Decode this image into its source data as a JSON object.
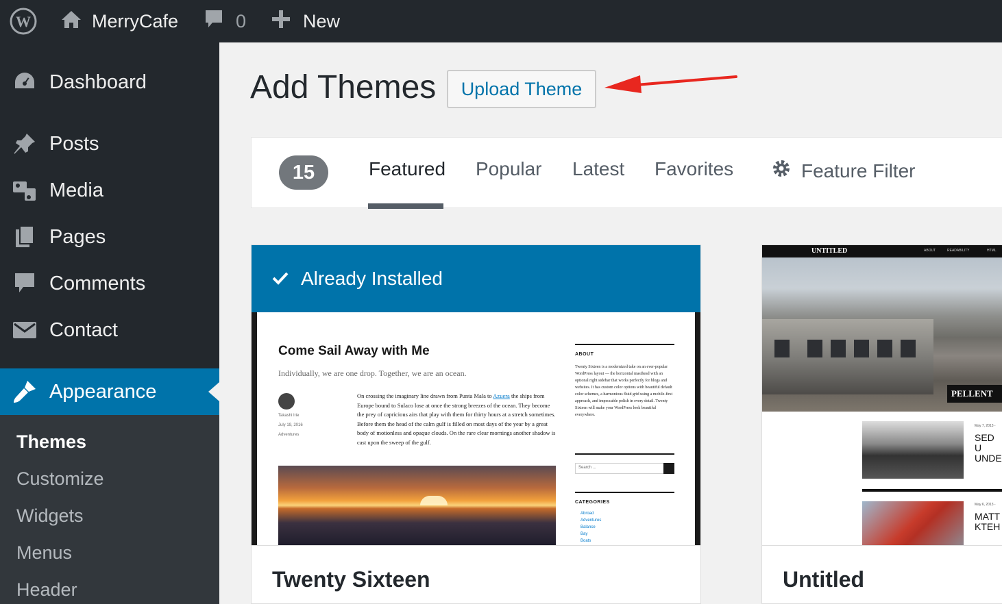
{
  "adminbar": {
    "site_name": "MerryCafe",
    "comment_count": "0",
    "new_label": "New"
  },
  "sidebar": {
    "items": [
      {
        "label": "Dashboard",
        "icon": "dashboard-icon"
      },
      {
        "label": "Posts",
        "icon": "pin-icon"
      },
      {
        "label": "Media",
        "icon": "media-icon"
      },
      {
        "label": "Pages",
        "icon": "pages-icon"
      },
      {
        "label": "Comments",
        "icon": "comment-icon"
      },
      {
        "label": "Contact",
        "icon": "envelope-icon"
      },
      {
        "label": "Appearance",
        "icon": "paintbrush-icon",
        "active": true
      }
    ],
    "submenu": [
      "Themes",
      "Customize",
      "Widgets",
      "Menus",
      "Header"
    ]
  },
  "main": {
    "title": "Add Themes",
    "upload_button": "Upload Theme",
    "theme_count": "15",
    "tabs": [
      "Featured",
      "Popular",
      "Latest",
      "Favorites"
    ],
    "active_tab": "Featured",
    "feature_filter": "Feature Filter"
  },
  "themes": [
    {
      "name": "Twenty Sixteen",
      "status": "Already Installed",
      "preview": {
        "post_title": "Come Sail Away with Me",
        "tagline": "Individually, we are one drop. Together, we are an ocean.",
        "author": "Takashi Irie",
        "date": "July 19, 2016",
        "category": "Adventures",
        "body_before_link": "On crossing the imaginary line drawn from Punta Mala to ",
        "body_link": "Azuera",
        "body_after_link": " the ships from Europe bound to Sulaco lose at once the strong breezes of the ocean. They become the prey of capricious airs that play with them for thirty hours at a stretch sometimes. Before them the head of the calm gulf is filled on most days of the year by a great body of motionless and opaque clouds. On the rare clear mornings another shadow is cast upon the sweep of the gulf.",
        "about_heading": "ABOUT",
        "about_text": "Twenty Sixteen is a modernized take on an ever-popular WordPress layout — the horizontal masthead with an optional right sidebar that works perfectly for blogs and websites. It has custom color options with beautiful default color schemes, a harmonious fluid grid using a mobile-first approach, and impeccable polish in every detail. Twenty Sixteen will make your WordPress look beautiful everywhere.",
        "search_placeholder": "Search ...",
        "categories_heading": "CATEGORIES",
        "categories": [
          "Abroad",
          "Adventures",
          "Balance",
          "Bay",
          "Boats"
        ]
      }
    },
    {
      "name": "Untitled",
      "preview": {
        "logo": "UNTITLED",
        "nav": [
          "ABOUT",
          "READABILITY",
          "HTML"
        ],
        "badge": "PELLENT",
        "date1": "May 7, 2013 -",
        "headline1": "SED U UNDE",
        "date2": "May 6, 2013 -",
        "headline2": "MATT KTEH"
      }
    }
  ],
  "colors": {
    "adminbar_bg": "#23282d",
    "accent_blue": "#0073aa",
    "annotation_arrow": "#e8271f"
  }
}
